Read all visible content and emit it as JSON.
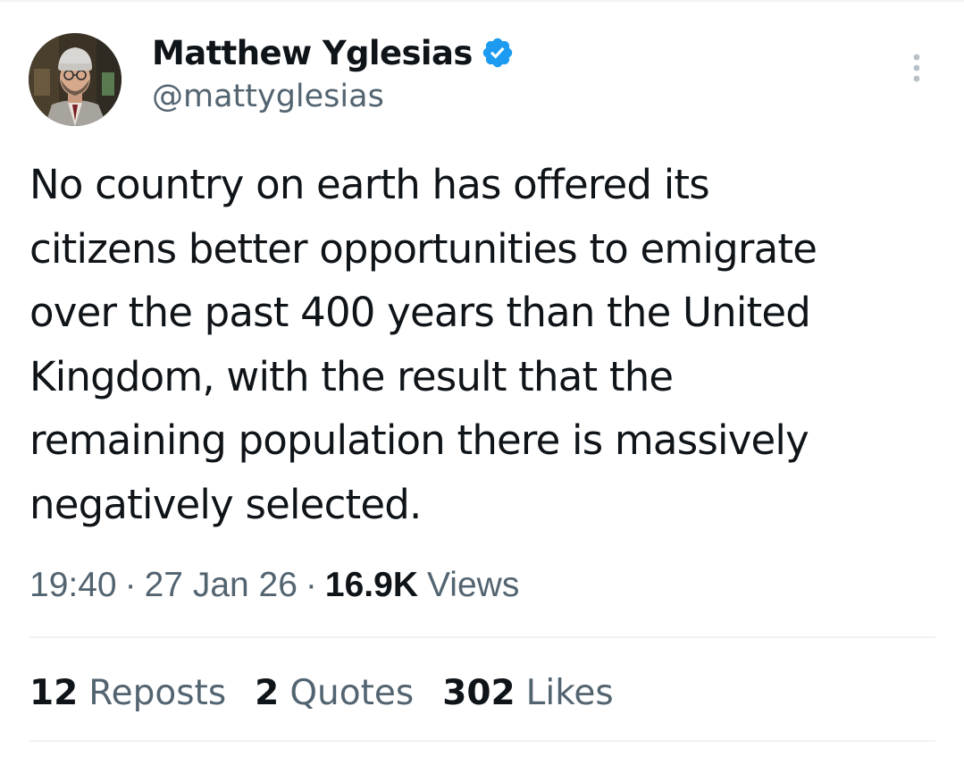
{
  "author": {
    "display_name": "Matthew Yglesias",
    "handle": "@mattyglesias",
    "verified": true
  },
  "icons": {
    "verified": "verified-badge-icon",
    "more": "more-options-icon"
  },
  "tweet": {
    "text_lines": [
      "No country on earth has offered its",
      "citizens better opportunities to emigrate",
      "over the past 400 years than the United",
      "Kingdom, with the result that the",
      "remaining population there is massively",
      "negatively selected."
    ]
  },
  "meta": {
    "time": "19:40",
    "separator": "·",
    "date": "27 Jan 26",
    "views_count": "16.9K",
    "views_label": "Views"
  },
  "stats": {
    "reposts": {
      "count": "12",
      "label": "Reposts"
    },
    "quotes": {
      "count": "2",
      "label": "Quotes"
    },
    "likes": {
      "count": "302",
      "label": "Likes"
    }
  },
  "colors": {
    "text_primary": "#0f1419",
    "text_secondary": "#536471",
    "verified_blue": "#1d9bf0",
    "divider": "#eff3f4"
  }
}
